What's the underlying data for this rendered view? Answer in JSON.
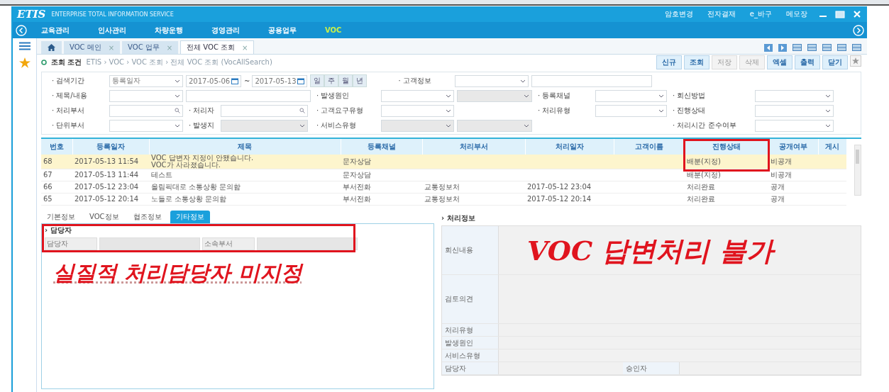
{
  "header": {
    "logo": "ETIS",
    "subtitle": "ENTERPRISE TOTAL INFORMATION SERVICE",
    "links": [
      "암호변경",
      "전자결재",
      "e_바구",
      "메모장"
    ]
  },
  "menu": [
    {
      "label": "교육관리",
      "selected": false
    },
    {
      "label": "인사관리",
      "selected": false
    },
    {
      "label": "차량운행",
      "selected": false
    },
    {
      "label": "경영관리",
      "selected": false
    },
    {
      "label": "공용업무",
      "selected": false
    },
    {
      "label": "VOC",
      "selected": true
    }
  ],
  "tabs": [
    {
      "label": "VOC 메인",
      "close": "×",
      "selected": false
    },
    {
      "label": "VOC 업무",
      "close": "×",
      "selected": false
    },
    {
      "label": "전체 VOC 조회",
      "close": "×",
      "selected": true
    }
  ],
  "condition": {
    "title": "조회 조건",
    "breadcrumb": "ETIS › VOC › VOC 조회 › 전체 VOC 조회 (VocAllSearch)"
  },
  "toolbar": [
    {
      "label": "신규",
      "disabled": false
    },
    {
      "label": "조회",
      "disabled": false
    },
    {
      "label": "저장",
      "disabled": true
    },
    {
      "label": "삭제",
      "disabled": true
    },
    {
      "label": "엑셀",
      "disabled": false
    },
    {
      "label": "출력",
      "disabled": false
    },
    {
      "label": "닫기",
      "disabled": false
    }
  ],
  "search_first_row": {
    "label": "· 검색기간",
    "type_value": "등록일자",
    "from": "2017-05-06",
    "separator": "~",
    "to": "2017-05-13",
    "periods": [
      "일",
      "주",
      "월",
      "년"
    ],
    "customer_label": "· 고객정보"
  },
  "search_rows": [
    [
      {
        "kind": "label",
        "text": "· 제목/내용"
      },
      {
        "kind": "select"
      },
      {
        "kind": "text"
      },
      {
        "kind": "label",
        "text": "· 발생원인"
      },
      {
        "kind": "select"
      },
      {
        "kind": "select",
        "disabled": true
      },
      {
        "kind": "label",
        "text": "· 등록채널"
      },
      {
        "kind": "select"
      },
      {
        "kind": "label",
        "text": "· 회신방법"
      },
      {
        "kind": "select"
      }
    ],
    [
      {
        "kind": "label",
        "text": "· 처리부서"
      },
      {
        "kind": "search"
      },
      {
        "kind": "group",
        "items": [
          {
            "kind": "label",
            "text": "· 처리자"
          },
          {
            "kind": "search"
          }
        ]
      },
      {
        "kind": "label",
        "text": "· 고객요구유형"
      },
      {
        "kind": "select"
      },
      {
        "kind": "blank"
      },
      {
        "kind": "label",
        "text": "· 처리유형"
      },
      {
        "kind": "select"
      },
      {
        "kind": "label",
        "text": "· 진행상태"
      },
      {
        "kind": "select"
      }
    ],
    [
      {
        "kind": "label",
        "text": "· 단위부서"
      },
      {
        "kind": "select"
      },
      {
        "kind": "group",
        "items": [
          {
            "kind": "label",
            "text": "· 발생지"
          },
          {
            "kind": "select",
            "disabled": true
          }
        ]
      },
      {
        "kind": "label",
        "text": "· 서비스유형"
      },
      {
        "kind": "select",
        "disabled": true
      },
      {
        "kind": "select",
        "disabled": true
      },
      {
        "kind": "blank"
      },
      {
        "kind": "blank"
      },
      {
        "kind": "label",
        "text": "· 처리시간 준수여부"
      },
      {
        "kind": "select"
      }
    ]
  ],
  "table": {
    "columns": [
      "번호",
      "등록일자",
      "제목",
      "등록채널",
      "처리부서",
      "처리일자",
      "고객이름",
      "진행상태",
      "공개여부",
      "게시"
    ],
    "rows": [
      {
        "selected": true,
        "cells": [
          "68",
          "2017-05-13 11:54",
          "VOC 답변자 지정이 안됐습니다.\nVOC가 사라졌습니다.",
          "문자상담",
          null,
          null,
          null,
          "배분(지정)",
          "비공개",
          null
        ]
      },
      {
        "selected": false,
        "cells": [
          "67",
          "2017-05-13 11:44",
          "테스트",
          "문자상담",
          null,
          null,
          null,
          "배분(지정)",
          "비공개",
          null
        ]
      },
      {
        "selected": false,
        "cells": [
          "66",
          "2017-05-12 23:04",
          "올림픽대로 소통상황 문의함",
          "부서전화",
          "교통정보처",
          "2017-05-12 23:04",
          null,
          "처리완료",
          "공개",
          null
        ]
      },
      {
        "selected": false,
        "cells": [
          "65",
          "2017-05-12 20:14",
          "노들로 소통상황 문의함",
          "부서전화",
          "교통정보처",
          "2017-05-12 20:14",
          null,
          "처리완료",
          "공개",
          null
        ]
      }
    ]
  },
  "detail_tabs": [
    {
      "label": "기본정보",
      "selected": false
    },
    {
      "label": "VOC정보",
      "selected": false
    },
    {
      "label": "협조정보",
      "selected": false
    },
    {
      "label": "기타정보",
      "selected": true
    }
  ],
  "manager_section": {
    "marker": "›",
    "title": "담당자",
    "fields": [
      "담당자",
      "소속부서"
    ]
  },
  "left_annotation": "실질적 처리담당자 미지정",
  "process_info": {
    "marker": "›",
    "title": "처리정보",
    "rows": [
      {
        "label": "회신내용",
        "kind": "tall"
      },
      {
        "label": "검토의견",
        "kind": "tall"
      },
      {
        "label": "처리유형",
        "kind": "line"
      },
      {
        "label": "발생원인",
        "kind": "line"
      },
      {
        "label": "서비스유형",
        "kind": "line"
      },
      {
        "label": "담당자",
        "kind": "pair",
        "second_label": "승인자"
      }
    ]
  },
  "right_annotation": "VOC 답변처리 불가"
}
